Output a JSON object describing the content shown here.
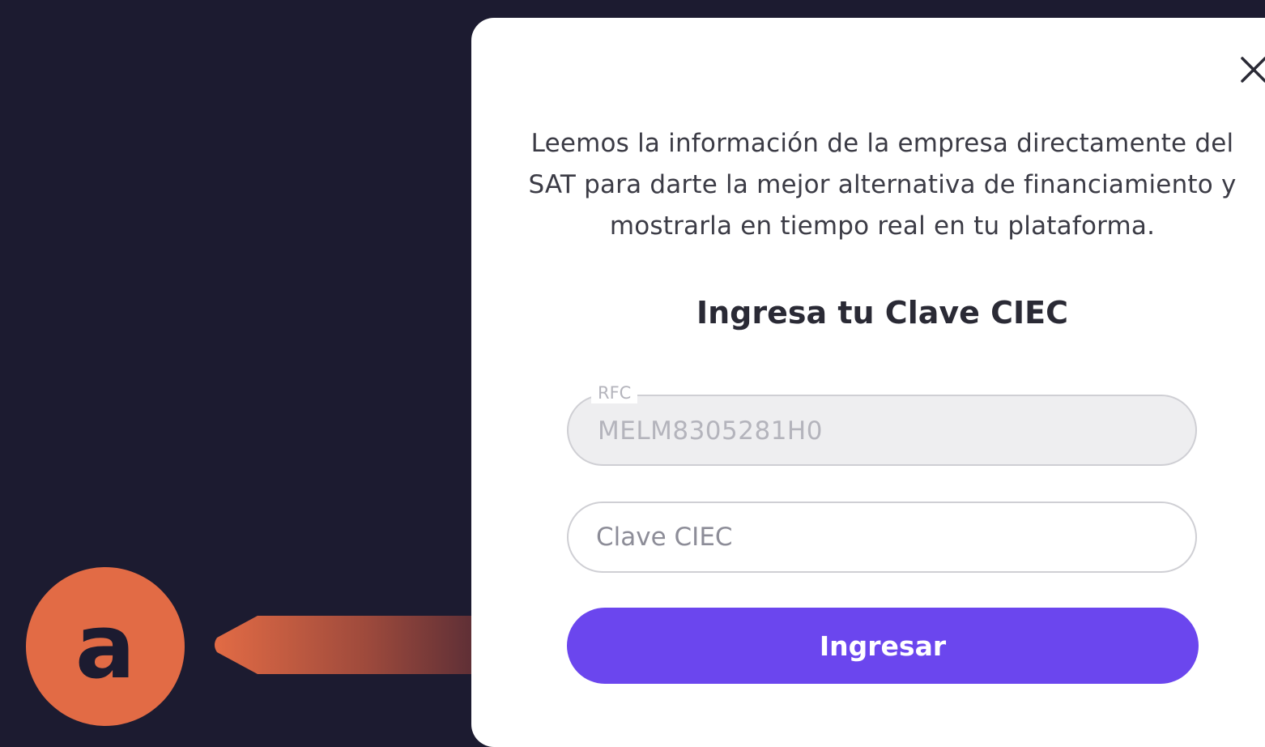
{
  "modal": {
    "intro_line_1": "Leemos la información de la empresa directamente del",
    "intro_line_2": "SAT para darte la mejor alternativa de financiamiento y",
    "intro_line_3": "mostrarla en tiempo real en tu plataforma.",
    "heading": "Ingresa tu Clave CIEC",
    "close_icon": "close-icon",
    "rfc_field": {
      "label": "RFC",
      "value": "MELM8305281H0",
      "disabled": true
    },
    "ciec_field": {
      "placeholder": "Clave CIEC",
      "value": ""
    },
    "submit_label": "Ingresar"
  },
  "annotation": {
    "badge_letter": "a"
  },
  "colors": {
    "background": "#1c1b30",
    "modal": "#ffffff",
    "primary_button": "#6b46ee",
    "annotation_badge": "#e26b45",
    "disabled_field": "#eeeef0"
  }
}
